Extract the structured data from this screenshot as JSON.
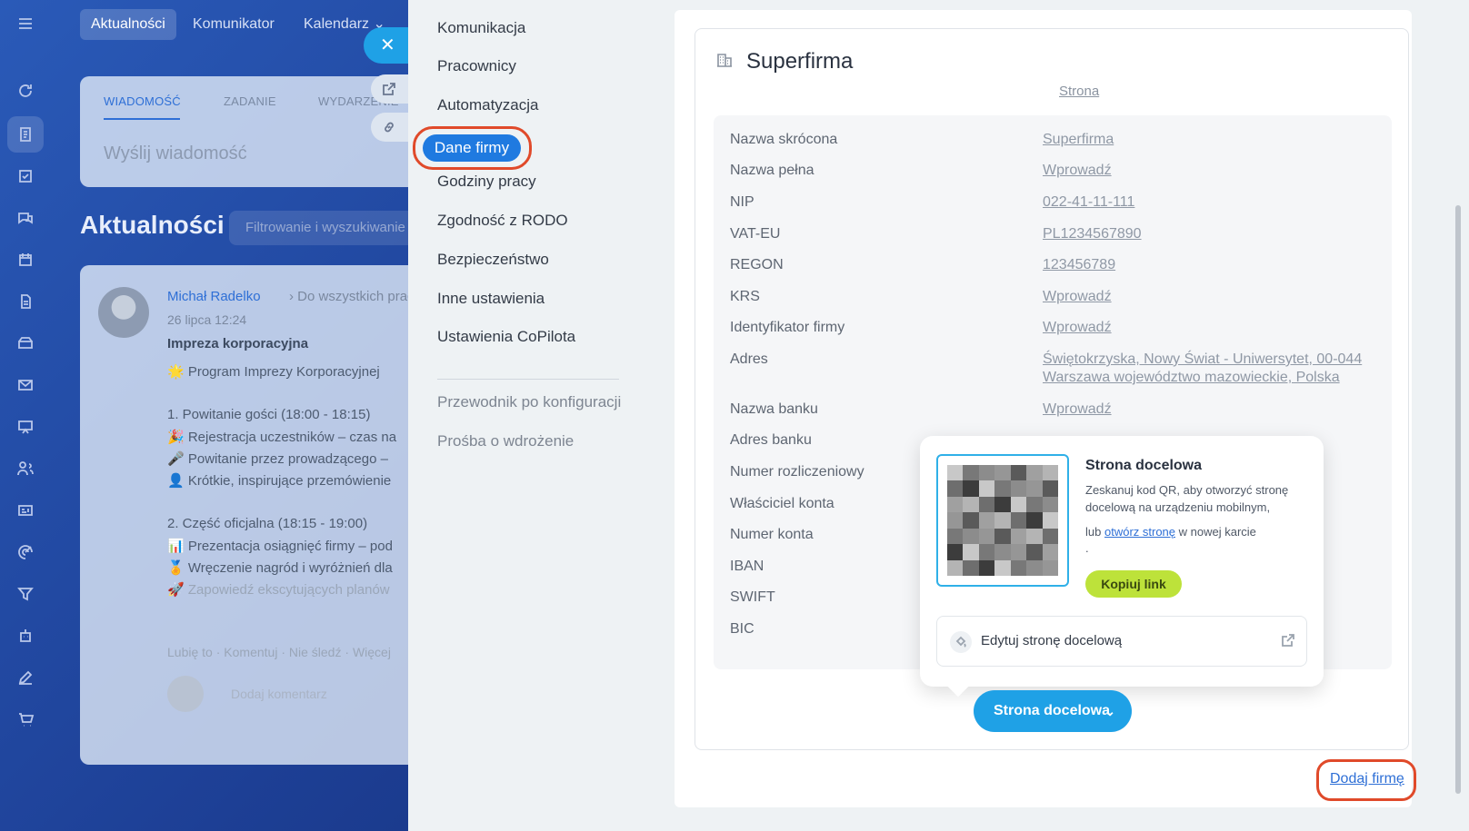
{
  "background_app": {
    "top_tabs": [
      "Aktualności",
      "Komunikator",
      "Kalendarz"
    ],
    "composer": {
      "tabs": [
        "WIADOMOŚĆ",
        "ZADANIE",
        "WYDARZENIE"
      ],
      "placeholder": "Wyślij wiadomość"
    },
    "feed": {
      "title": "Aktualności",
      "filter_placeholder": "Filtrowanie i wyszukiwanie"
    },
    "post": {
      "author": "Michał Radelko",
      "target": "Do wszystkich pracowników",
      "date": "26 lipca 12:24",
      "title": "Impreza korporacyjna",
      "lines": [
        "🌟 Program Imprezy Korporacyjnej",
        "1. Powitanie gości (18:00 - 18:15)",
        "🎉 Rejestracja uczestników – czas na",
        "🎤 Powitanie przez prowadzącego –",
        "👤 Krótkie, inspirujące przemówienie",
        "2. Część oficjalna (18:15 - 19:00)",
        "📊 Prezentacja osiągnięć firmy – pod",
        "🏅 Wręczenie nagród i wyróżnień dla",
        "🚀 Zapowiedź ekscytujących planów"
      ],
      "actions": [
        "Lubię to",
        "Komentuj",
        "Nie śledź",
        "Więcej"
      ],
      "comment_placeholder": "Dodaj komentarz"
    }
  },
  "settings_nav": {
    "items": [
      {
        "label": "Komunikacja"
      },
      {
        "label": "Pracownicy"
      },
      {
        "label": "Automatyzacja"
      },
      {
        "label": "Dane firmy"
      },
      {
        "label": "Godziny pracy"
      },
      {
        "label": "Zgodność z RODO"
      },
      {
        "label": "Bezpieczeństwo"
      },
      {
        "label": "Inne ustawienia"
      },
      {
        "label": "Ustawienia CoPilota"
      }
    ],
    "active_item": "Dane firmy",
    "secondary_items": [
      {
        "label": "Przewodnik po konfiguracji"
      },
      {
        "label": "Prośba o wdrożenie"
      }
    ]
  },
  "company": {
    "name": "Superfirma",
    "page_link": "Strona",
    "fields": [
      {
        "label": "Nazwa skrócona",
        "value": "Superfirma"
      },
      {
        "label": "Nazwa pełna",
        "value": "Wprowadź"
      },
      {
        "label": "NIP",
        "value": "022-41-11-111"
      },
      {
        "label": "VAT-EU",
        "value": "PL1234567890"
      },
      {
        "label": "REGON",
        "value": "123456789"
      },
      {
        "label": "KRS",
        "value": "Wprowadź"
      },
      {
        "label": "Identyfikator firmy",
        "value": "Wprowadź"
      },
      {
        "label": "Adres",
        "value": "Świętokrzyska, Nowy Świat - Uniwersytet, 00-044",
        "value2": "Warszawa województwo mazowieckie, Polska"
      },
      {
        "label": "Nazwa banku",
        "value": "Wprowadź"
      },
      {
        "label": "Adres banku",
        "value": ""
      },
      {
        "label": "Numer rozliczeniowy",
        "value": ""
      },
      {
        "label": "Właściciel konta",
        "value": ""
      },
      {
        "label": "Numer konta",
        "value": ""
      },
      {
        "label": "IBAN",
        "value": ""
      },
      {
        "label": "SWIFT",
        "value": ""
      },
      {
        "label": "BIC",
        "value": ""
      }
    ]
  },
  "landing_popup": {
    "title": "Strona docelowa",
    "description": "Zeskanuj kod QR, aby otworzyć stronę docelową na urządzeniu mobilnym,",
    "or_prefix": "lub",
    "open_link": "otwórz stronę",
    "or_suffix": "w nowej karcie",
    "trailing_dot": ".",
    "copy_button": "Kopiuj link",
    "edit_label": "Edytuj stronę docelową"
  },
  "landing_button": {
    "label": "Strona docelowa"
  },
  "add_company": {
    "label": "Dodaj firmę"
  },
  "colors": {
    "accent_blue": "#1fa1e6",
    "nav_active": "#1f7ae0",
    "highlight_ring": "#e04a2a",
    "copy_green": "#bde23a"
  }
}
